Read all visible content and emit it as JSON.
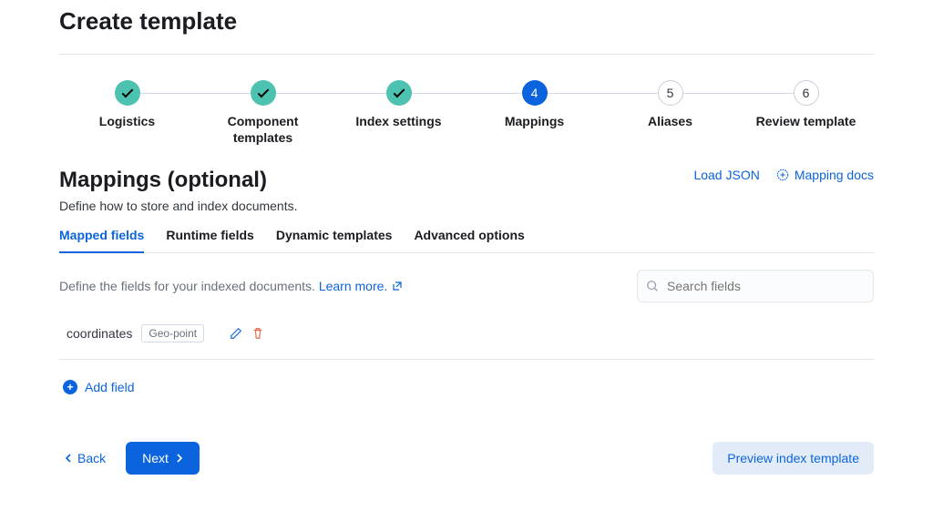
{
  "page": {
    "title": "Create template"
  },
  "stepper": {
    "steps": [
      {
        "label": "Logistics",
        "state": "done"
      },
      {
        "label": "Component templates",
        "state": "done"
      },
      {
        "label": "Index settings",
        "state": "done"
      },
      {
        "label": "Mappings",
        "state": "current",
        "number": "4"
      },
      {
        "label": "Aliases",
        "state": "pending",
        "number": "5"
      },
      {
        "label": "Review template",
        "state": "pending",
        "number": "6"
      }
    ]
  },
  "section": {
    "title": "Mappings (optional)",
    "description": "Define how to store and index documents.",
    "actions": {
      "load_json": "Load JSON",
      "docs": "Mapping docs"
    }
  },
  "tabs": [
    {
      "label": "Mapped fields",
      "active": true
    },
    {
      "label": "Runtime fields",
      "active": false
    },
    {
      "label": "Dynamic templates",
      "active": false
    },
    {
      "label": "Advanced options",
      "active": false
    }
  ],
  "helper": {
    "text": "Define the fields for your indexed documents. ",
    "link": "Learn more."
  },
  "search": {
    "placeholder": "Search fields"
  },
  "fields": [
    {
      "name": "coordinates",
      "type": "Geo-point"
    }
  ],
  "add_field_label": "Add field",
  "footer": {
    "back": "Back",
    "next": "Next",
    "preview": "Preview index template"
  }
}
